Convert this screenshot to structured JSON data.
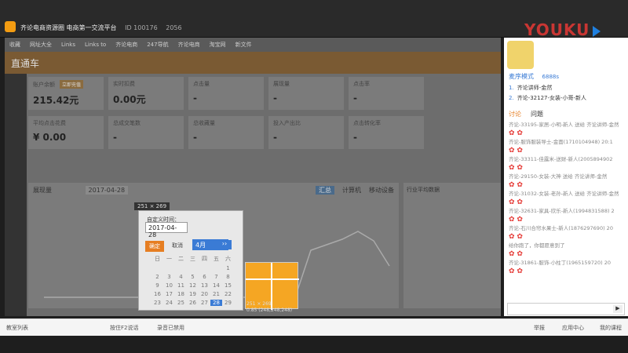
{
  "window": {
    "title": "齐论电商资源圈 电商第一交流平台",
    "id_text": "ID 100176",
    "followers": "2056",
    "brand": "YOUKU"
  },
  "browser_bar": [
    "收藏",
    "网址大全",
    "Links",
    "Links to",
    "齐论电商",
    "247导航",
    "齐论电商",
    "淘宝网",
    "新文件"
  ],
  "page": {
    "header": "直通车",
    "cards_row1": [
      {
        "label": "账户余额",
        "value": "215.42元",
        "chip": "立即充值"
      },
      {
        "label": "实时扣费",
        "value": "0.00元",
        "chip": ""
      },
      {
        "label": "点击量",
        "value": "-",
        "chip": ""
      },
      {
        "label": "展现量",
        "value": "-",
        "chip": ""
      },
      {
        "label": "点击率",
        "value": "-",
        "chip": ""
      }
    ],
    "cards_row2": [
      {
        "label": "平均点击花费",
        "value": "¥ 0.00"
      },
      {
        "label": "总成交笔数",
        "value": "-"
      },
      {
        "label": "总收藏量",
        "value": "-"
      },
      {
        "label": "投入产出比",
        "value": "-"
      },
      {
        "label": "点击转化率",
        "value": "-"
      }
    ],
    "chart_header": {
      "label": "展现量",
      "date": "2017-04-28",
      "tabs": [
        "汇总",
        "计算机",
        "移动设备"
      ]
    },
    "side_panel_title": "行业平均数据"
  },
  "popup": {
    "size_tag": "251 × 269",
    "label": "自定义时间：",
    "date_value": "2017-04-28",
    "ok": "确定",
    "cancel": "取消",
    "month": "4月",
    "weekdays": [
      "日",
      "一",
      "二",
      "三",
      "四",
      "五",
      "六"
    ],
    "days": [
      "",
      "",
      "",
      "",
      "",
      "",
      "1",
      "2",
      "3",
      "4",
      "5",
      "6",
      "7",
      "8",
      "9",
      "10",
      "11",
      "12",
      "13",
      "14",
      "15",
      "16",
      "17",
      "18",
      "19",
      "20",
      "21",
      "22",
      "23",
      "24",
      "25",
      "26",
      "27",
      "28",
      "29"
    ],
    "selected_day": "28"
  },
  "popup2": {
    "info1": "251 × 269",
    "info2": "0.85 (248,248,248)"
  },
  "right_panel": {
    "mode_label": "麦序模式",
    "mode_count": "6888s",
    "speakers": [
      {
        "num": "1",
        "name": "齐论讲师-金然"
      },
      {
        "num": "2",
        "name": "齐论-32127-女装-小哥-新人"
      }
    ],
    "tabs": [
      "讨论",
      "问题"
    ],
    "chat": [
      "齐论-33195-家居-小明-新人 送给 齐论讲师-金然",
      "齐论-服饰服装导士-金面(1710104948) 20:1",
      "齐论-33311-佳露米-送财-新人(2005894902",
      "齐论-29150-女装-大神 送给 齐论讲师-金然",
      "齐论-31032-女装-老孙-新人 送给 齐论讲师-金然",
      "齐论-32631-家具-欣乐-新人(1994831588) 2",
      "齐论-石川合帘水果士-新人(1876297690) 20",
      "给你跑了，你都愿意到了",
      "齐论-31861-服饰-小柱丁(1965159720) 20"
    ],
    "send_icon": "▶"
  },
  "statusbar": {
    "left": "教室列表",
    "ptt": "按住F2说话",
    "rec": "录音已禁用",
    "items": [
      "举报",
      "应用中心",
      "我的课程"
    ]
  }
}
